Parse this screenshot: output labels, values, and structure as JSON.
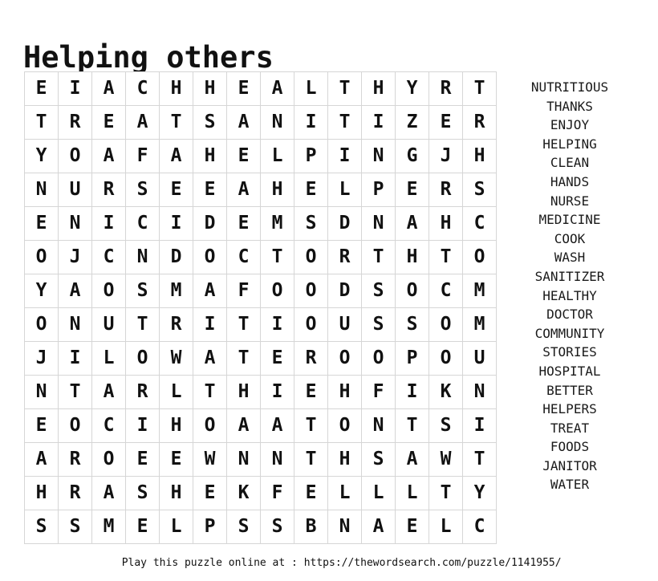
{
  "puzzle": {
    "title": "Helping others",
    "grid": {
      "rows": 14,
      "cols": 14,
      "letters": [
        [
          "E",
          "I",
          "A",
          "C",
          "H",
          "H",
          "E",
          "A",
          "L",
          "T",
          "H",
          "Y",
          "R",
          "T"
        ],
        [
          "T",
          "R",
          "E",
          "A",
          "T",
          "S",
          "A",
          "N",
          "I",
          "T",
          "I",
          "Z",
          "E",
          "R"
        ],
        [
          "Y",
          "O",
          "A",
          "F",
          "A",
          "H",
          "E",
          "L",
          "P",
          "I",
          "N",
          "G",
          "J",
          "H"
        ],
        [
          "N",
          "U",
          "R",
          "S",
          "E",
          "E",
          "A",
          "H",
          "E",
          "L",
          "P",
          "E",
          "R",
          "S"
        ],
        [
          "E",
          "N",
          "I",
          "C",
          "I",
          "D",
          "E",
          "M",
          "S",
          "D",
          "N",
          "A",
          "H",
          "C"
        ],
        [
          "O",
          "J",
          "C",
          "N",
          "D",
          "O",
          "C",
          "T",
          "O",
          "R",
          "T",
          "H",
          "T",
          "O"
        ],
        [
          "Y",
          "A",
          "O",
          "S",
          "M",
          "A",
          "F",
          "O",
          "O",
          "D",
          "S",
          "O",
          "C",
          "M"
        ],
        [
          "O",
          "N",
          "U",
          "T",
          "R",
          "I",
          "T",
          "I",
          "O",
          "U",
          "S",
          "S",
          "O",
          "M"
        ],
        [
          "J",
          "I",
          "L",
          "O",
          "W",
          "A",
          "T",
          "E",
          "R",
          "O",
          "O",
          "P",
          "O",
          "U"
        ],
        [
          "N",
          "T",
          "A",
          "R",
          "L",
          "T",
          "H",
          "I",
          "E",
          "H",
          "F",
          "I",
          "K",
          "N"
        ],
        [
          "E",
          "O",
          "C",
          "I",
          "H",
          "O",
          "A",
          "A",
          "T",
          "O",
          "N",
          "T",
          "S",
          "I"
        ],
        [
          "A",
          "R",
          "O",
          "E",
          "E",
          "W",
          "N",
          "N",
          "T",
          "H",
          "S",
          "A",
          "W",
          "T"
        ],
        [
          "H",
          "R",
          "A",
          "S",
          "H",
          "E",
          "K",
          "F",
          "E",
          "L",
          "L",
          "L",
          "T",
          "Y"
        ],
        [
          "S",
          "S",
          "M",
          "E",
          "L",
          "P",
          "S",
          "S",
          "B",
          "N",
          "A",
          "E",
          "L",
          "C"
        ]
      ]
    },
    "word_list": [
      "NUTRITIOUS",
      "THANKS",
      "ENJOY",
      "HELPING",
      "CLEAN",
      "HANDS",
      "NURSE",
      "MEDICINE",
      "COOK",
      "WASH",
      "SANITIZER",
      "HEALTHY",
      "DOCTOR",
      "COMMUNITY",
      "STORIES",
      "HOSPITAL",
      "BETTER",
      "HELPERS",
      "TREAT",
      "FOODS",
      "JANITOR",
      "WATER"
    ],
    "footer": {
      "text": "Play this puzzle online at : https://thewordsearch.com/puzzle/1141955/",
      "prefix": "Play this puzzle online at : ",
      "url": "https://thewordsearch.com/puzzle/1141955/"
    },
    "colors": {
      "background": "#ffffff",
      "text": "#111111",
      "grid_border": "#d6d6d6"
    }
  }
}
